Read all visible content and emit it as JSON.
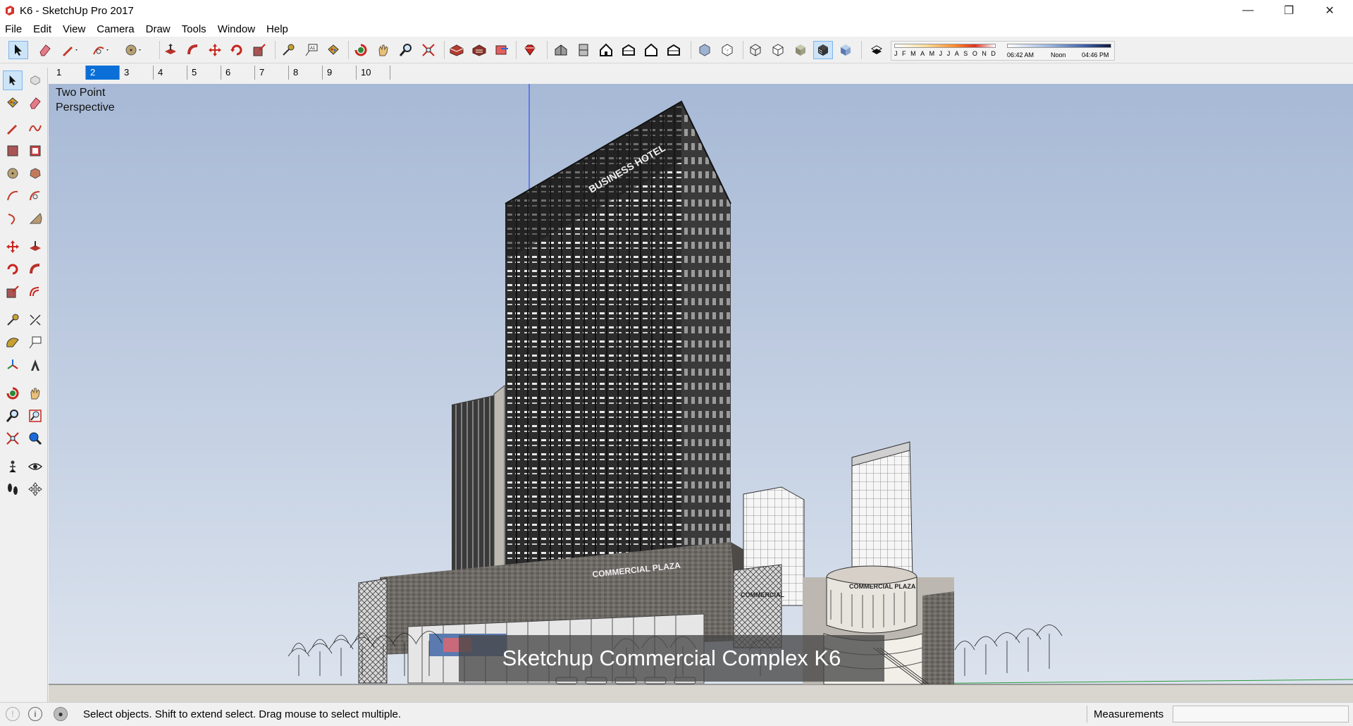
{
  "window": {
    "title": "K6 - SketchUp Pro 2017",
    "minimize_glyph": "—",
    "maximize_glyph": "❐",
    "close_glyph": "✕"
  },
  "menu": [
    "File",
    "Edit",
    "View",
    "Camera",
    "Draw",
    "Tools",
    "Window",
    "Help"
  ],
  "toolbar": {
    "shadow_months": [
      "J",
      "F",
      "M",
      "A",
      "M",
      "J",
      "J",
      "A",
      "S",
      "O",
      "N",
      "D"
    ],
    "time_start": "06:42 AM",
    "time_mid": "Noon",
    "time_end": "04:46 PM"
  },
  "scenes": {
    "tabs": [
      "1",
      "2",
      "3",
      "4",
      "5",
      "6",
      "7",
      "8",
      "9",
      "10"
    ],
    "active": "2"
  },
  "viewport": {
    "view_label_line1": "Two Point",
    "view_label_line2": "Perspective",
    "caption": "Sketchup Commercial Complex K6",
    "sign_hotel": "BUSINESS HOTEL",
    "sign_plaza": "COMMERCIAL PLAZA",
    "sign_plaza_round": "COMMERCIAL PLAZA",
    "sign_small": "COMMERCIAL",
    "sky_top": "#a7b9d6",
    "sky_bottom": "#dde4ee"
  },
  "status": {
    "message": "Select objects. Shift to extend select. Drag mouse to select multiple.",
    "measurements_label": "Measurements",
    "measurements_value": ""
  }
}
